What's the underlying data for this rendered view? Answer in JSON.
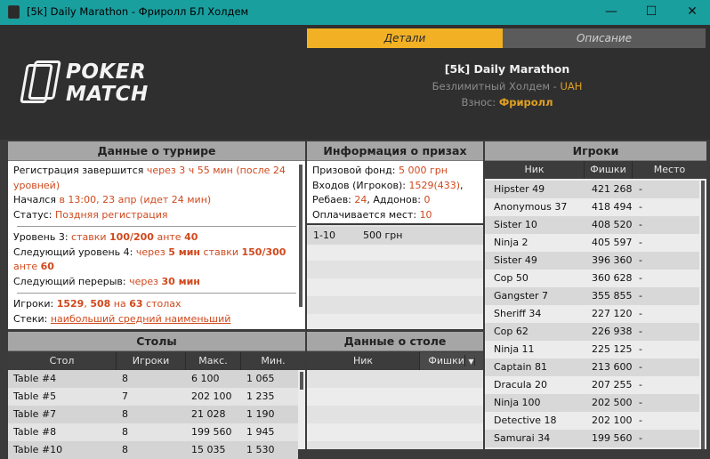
{
  "window": {
    "title": "[5k] Daily Marathon - Фриролл БЛ Холдем",
    "min": "—",
    "max": "☐",
    "close": "✕"
  },
  "tabs": {
    "details": "Детали",
    "description": "Описание"
  },
  "logo": {
    "line1": "POKER",
    "line2": "MATCH"
  },
  "tournament": {
    "name": "[5k] Daily Marathon",
    "game": "Безлимитный Холдем - ",
    "currency": "UAH",
    "fee_label": "Взнос: ",
    "fee_value": "Фриролл"
  },
  "info": {
    "title": "Данные о турнире",
    "reg_label": "Регистрация завершится ",
    "reg_value": "через 3 ч 55 мин (после 24 уровней)",
    "started_label": "Начался ",
    "started_value": "в 13:00, 23 апр (идет 24 мин)",
    "status_label": "Статус: ",
    "status_value": "Поздняя регистрация",
    "level_label": "Уровень 3: ",
    "level_stakes_w": "ставки ",
    "level_stakes": "100/200",
    "level_ante_w": " анте ",
    "level_ante": "40",
    "next_label": "Следующий уровень 4: ",
    "next_in": "через ",
    "next_time": "5 мин",
    "next_stakes_w": " ставки ",
    "next_stakes": "150/300",
    "next_ante_w": " анте ",
    "next_ante": "60",
    "break_label": "Следующий перерыв: ",
    "break_in": "через ",
    "break_time": "30 мин",
    "players_label": "Игроки: ",
    "players_a": "1529",
    "players_b": "508",
    "players_on": " на ",
    "players_c": "63",
    "players_tables": " столах",
    "stacks_label": "Стеки: ",
    "stacks_value": "наибольший  средний  наименьший"
  },
  "prizes": {
    "title": "Информация о призах",
    "pool_label": "Призовой фонд: ",
    "pool_value": "5 000 грн",
    "entries_label": "Входов (Игроков): ",
    "entries_value": "1529(433)",
    "rebuys_label": "Ребаев: ",
    "rebuys_value": "24",
    "addons_label": ", Аддонов: ",
    "addons_value": "0",
    "paid_label": "Оплачивается мест: ",
    "paid_value": "10",
    "rows": [
      {
        "place": "1-10",
        "prize": "500 грн"
      }
    ]
  },
  "players": {
    "title": "Игроки",
    "col_nick": "Ник",
    "col_chips": "Фишки",
    "col_place": "Место",
    "rows": [
      {
        "nick": "Hipster 49",
        "chips": "421 268",
        "place": "-"
      },
      {
        "nick": "Anonymous 37",
        "chips": "418 494",
        "place": "-"
      },
      {
        "nick": "Sister 10",
        "chips": "408 520",
        "place": "-"
      },
      {
        "nick": "Ninja 2",
        "chips": "405 597",
        "place": "-"
      },
      {
        "nick": "Sister 49",
        "chips": "396 360",
        "place": "-"
      },
      {
        "nick": "Cop 50",
        "chips": "360 628",
        "place": "-"
      },
      {
        "nick": "Gangster 7",
        "chips": "355 855",
        "place": "-"
      },
      {
        "nick": "Sheriff 34",
        "chips": "227 120",
        "place": "-"
      },
      {
        "nick": "Cop 62",
        "chips": "226 938",
        "place": "-"
      },
      {
        "nick": "Ninja 11",
        "chips": "225 125",
        "place": "-"
      },
      {
        "nick": "Captain 81",
        "chips": "213 600",
        "place": "-"
      },
      {
        "nick": "Dracula 20",
        "chips": "207 255",
        "place": "-"
      },
      {
        "nick": "Ninja 100",
        "chips": "202 500",
        "place": "-"
      },
      {
        "nick": "Detective 18",
        "chips": "202 100",
        "place": "-"
      },
      {
        "nick": "Samurai 34",
        "chips": "199 560",
        "place": "-"
      }
    ]
  },
  "tables": {
    "title": "Столы",
    "col_table": "Стол",
    "col_players": "Игроки",
    "col_max": "Макс.",
    "col_min": "Мин.",
    "rows": [
      {
        "table": "Table #4",
        "players": "8",
        "max": "6 100",
        "min": "1 065"
      },
      {
        "table": "Table #5",
        "players": "7",
        "max": "202 100",
        "min": "1 235"
      },
      {
        "table": "Table #7",
        "players": "8",
        "max": "21 028",
        "min": "1 190"
      },
      {
        "table": "Table #8",
        "players": "8",
        "max": "199 560",
        "min": "1 945"
      },
      {
        "table": "Table #10",
        "players": "8",
        "max": "15 035",
        "min": "1 530"
      }
    ]
  },
  "table_data": {
    "title": "Данные о столе",
    "col_nick": "Ник",
    "col_chips": "Фишки"
  }
}
